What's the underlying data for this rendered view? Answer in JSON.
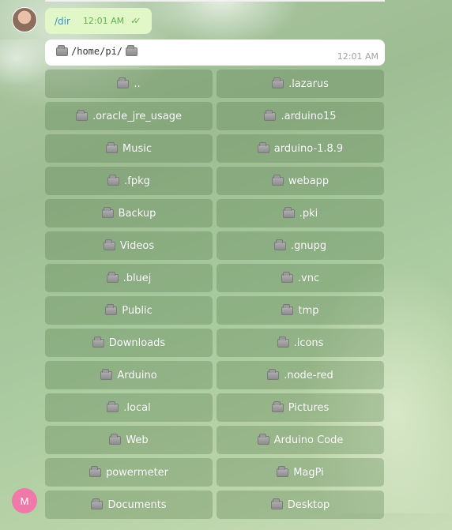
{
  "sent_message": {
    "text": "/dir",
    "time": "12:01 AM",
    "status": "read"
  },
  "reply_message": {
    "path_parts": [
      "/home/pi/"
    ],
    "time": "12:01 AM"
  },
  "bot_avatar": {
    "initial": "M",
    "color": "#ef7aa9"
  },
  "keyboard": {
    "buttons": [
      "..",
      ".lazarus",
      ".oracle_jre_usage",
      ".arduino15",
      "Music",
      "arduino-1.8.9",
      ".fpkg",
      "webapp",
      "Backup",
      ".pki",
      "Videos",
      ".gnupg",
      ".bluej",
      ".vnc",
      "Public",
      "tmp",
      "Downloads",
      ".icons",
      "Arduino",
      ".node-red",
      ".local",
      "Pictures",
      "Web",
      "Arduino Code",
      "powermeter",
      "MagPi",
      "Documents",
      "Desktop"
    ],
    "icon": "folder-icon"
  }
}
